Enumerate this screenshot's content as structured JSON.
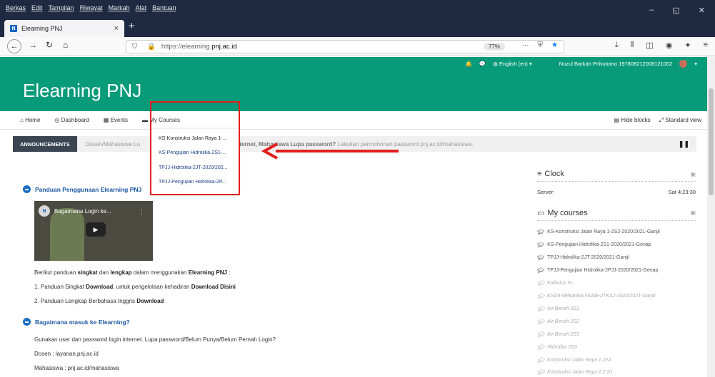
{
  "browser": {
    "menu": [
      "Berkas",
      "Edit",
      "Tampilan",
      "Riwayat",
      "Markah",
      "Alat",
      "Bantuan"
    ],
    "tab_title": "Elearning PNJ",
    "tab_close": "×",
    "new_tab": "+",
    "url_scheme": "https://elearning.",
    "url_domain": "pnj.ac.id",
    "zoom": "77%",
    "win_minimize": "–",
    "win_restore": "◱",
    "win_close": "✕"
  },
  "moodle": {
    "user_name": "Nuzul Barkah Prihutomo 197808212008121002",
    "language": "English (en) ▾",
    "site_title": "Elearning PNJ",
    "nav": {
      "home": "Home",
      "dashboard": "Dashboard",
      "events": "Events",
      "my_courses": "My Courses",
      "hide_blocks": "Hide blocks",
      "standard_view": "Standard view"
    },
    "announcement": {
      "label": "ANNOUNCEMENTS",
      "text_start": "Dosen/Mahasiswa Lu",
      "text_mid": "gin internet, Mahasiswa Lupa password?",
      "text_end": " Lakukan permohonan password pnj.ac.id/mahasiswa."
    },
    "dropdown": [
      "KS-Konstruksi Jalan Raya 1-...",
      "KS-Pengujian Hidrolika-2S1-...",
      "TPJJ-Hidrolika-2JT-2020/202...",
      "TPJJ-Pengujian Hidrolika-2P..."
    ],
    "content": {
      "section1_title": "Panduan Penggunaan Elearning PNJ",
      "video_title": "Bagaimana Login ke...",
      "guide_pre": "Berikut panduan ",
      "guide_b1": "singkat",
      "guide_mid": " dan ",
      "guide_b2": "lengkap",
      "guide_mid2": " dalam menggunakan ",
      "guide_b3": "Elearning PNJ",
      "guide_end": " :",
      "item1_pre": "1. Panduan Singkat ",
      "item1_b1": "Download",
      "item1_mid": ", untuk pengelolaan kehadiran ",
      "item1_b2": "Download Disini",
      "item2_pre": "2. Panduan Lengkap Berbahasa Inggris ",
      "item2_b": "Download",
      "section2_title": "Bagaimana masuk ke Elearning?",
      "login_text": "Gunakan user dan password login internet. Lupa password/Belum Punya/Belum Pernah Login?",
      "dosen": "Dosen : layanan.pnj.ac.id",
      "mahasiswa": "Mahasiswa : pnj.ac.id/mahasiswa"
    },
    "clock_block": {
      "title": "Clock",
      "server_label": "Server:",
      "server_time": "Sat 4:23:30"
    },
    "courses_block": {
      "title": "My courses",
      "active": [
        "KS-Konstruksi Jalan Raya 1-2S2-2020/2021-Ganjil",
        "KS-Pengujian Hidrolika-2S1-2020/2021-Genap",
        "TPJJ-Hidrolika-2JT-2020/2021-Ganjil",
        "TPJJ-Pengujian Hidrolika-2PJJ-2020/2021-Genap"
      ],
      "hidden": [
        "Kalkulus 5c",
        "KSD4-Mekanika Fluida-2TKS2-2020/2021-Ganjil",
        "Air Bersih 2S1",
        "Air Bersih 2S2",
        "Air Bersih 2S3",
        "Hidrolika 2S3",
        "Konstruksi Jalan Raya 1 2S1",
        "Konstruksi Jalan Raya 2 2.S1"
      ]
    }
  }
}
